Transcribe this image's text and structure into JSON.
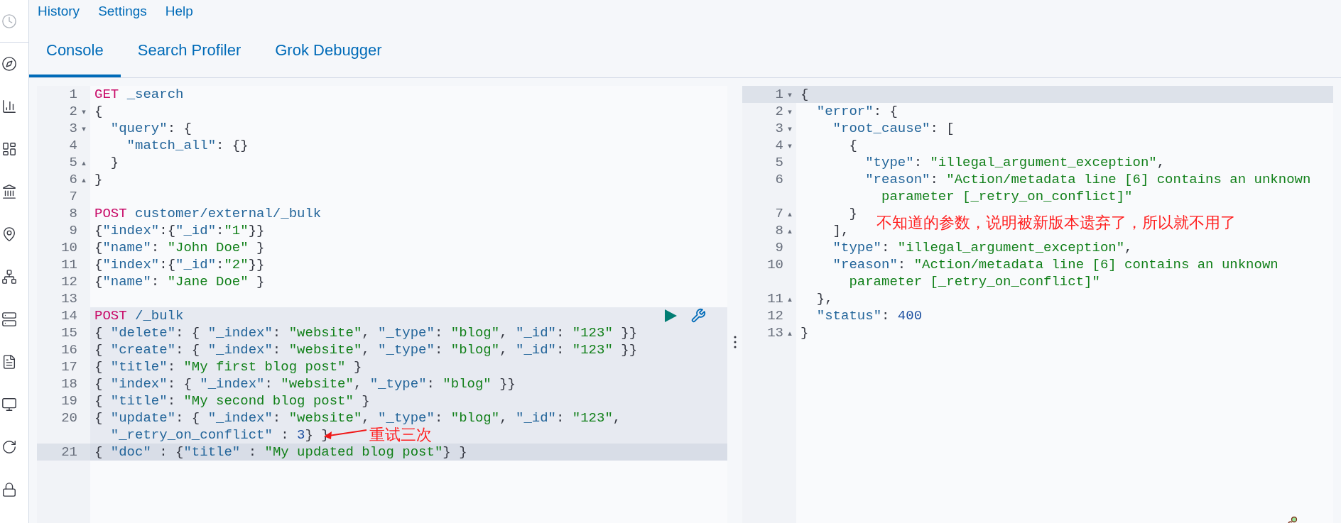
{
  "menu": [
    "History",
    "Settings",
    "Help"
  ],
  "tabs": [
    {
      "label": "Console",
      "selected": true
    },
    {
      "label": "Search Profiler",
      "selected": false
    },
    {
      "label": "Grok Debugger",
      "selected": false
    }
  ],
  "request_editor": {
    "note": "重试三次",
    "lines": [
      {
        "number": "1",
        "method": "GET",
        "path": "_search",
        "in_request": false,
        "active": false
      },
      {
        "number": "2",
        "text": "{",
        "fold": "▾",
        "in_request": false,
        "active": false
      },
      {
        "number": "3",
        "text": "  \"query\": {",
        "fold": "▾",
        "in_request": false,
        "active": false
      },
      {
        "number": "4",
        "text": "    \"match_all\": {}",
        "in_request": false,
        "active": false
      },
      {
        "number": "5",
        "text": "  }",
        "fold": "▴",
        "in_request": false,
        "active": false
      },
      {
        "number": "6",
        "text": "}",
        "fold": "▴",
        "in_request": false,
        "active": false
      },
      {
        "number": "7",
        "in_request": false,
        "active": false
      },
      {
        "number": "8",
        "method": "POST",
        "path": "customer/external/_bulk",
        "in_request": false,
        "active": false
      },
      {
        "number": "9",
        "text": "{\"index\":{\"_id\":\"1\"}}",
        "in_request": false,
        "active": false
      },
      {
        "number": "10",
        "text": "{\"name\": \"John Doe\" }",
        "in_request": false,
        "active": false
      },
      {
        "number": "11",
        "text": "{\"index\":{\"_id\":\"2\"}}",
        "in_request": false,
        "active": false
      },
      {
        "number": "12",
        "text": "{\"name\": \"Jane Doe\" }",
        "in_request": false,
        "active": false
      },
      {
        "number": "13",
        "in_request": false,
        "active": false
      },
      {
        "number": "14",
        "method": "POST",
        "path": "/_bulk",
        "in_request": true,
        "active": false
      },
      {
        "number": "15",
        "text": "{ \"delete\": { \"_index\": \"website\", \"_type\": \"blog\", \"_id\": \"123\" }}",
        "in_request": true,
        "active": false
      },
      {
        "number": "16",
        "text": "{ \"create\": { \"_index\": \"website\", \"_type\": \"blog\", \"_id\": \"123\" }}",
        "in_request": true,
        "active": false
      },
      {
        "number": "17",
        "text": "{ \"title\": \"My first blog post\" }",
        "in_request": true,
        "active": false
      },
      {
        "number": "18",
        "text": "{ \"index\": { \"_index\": \"website\", \"_type\": \"blog\" }}",
        "in_request": true,
        "active": false
      },
      {
        "number": "19",
        "text": "{ \"title\": \"My second blog post\" }",
        "in_request": true,
        "active": false
      },
      {
        "number": "20",
        "text": "{ \"update\": { \"_index\": \"website\", \"_type\": \"blog\", \"_id\": \"123\",",
        "wrap": "  \"_retry_on_conflict\" : 3} }",
        "in_request": true,
        "active": false
      },
      {
        "number": "21",
        "text": "{ \"doc\" : {\"title\" : \"My updated blog post\"} }",
        "in_request": true,
        "active": true
      }
    ]
  },
  "response_viewer": {
    "note": "不知道的参数，说明被新版本遗弃了，所以就不用了",
    "lines": [
      {
        "number": "1",
        "text": "{",
        "fold": "▾",
        "active": true
      },
      {
        "number": "2",
        "text": "  \"error\": {",
        "fold": "▾",
        "active": false
      },
      {
        "number": "3",
        "text": "    \"root_cause\": [",
        "fold": "▾",
        "active": false
      },
      {
        "number": "4",
        "text": "      {",
        "fold": "▾",
        "active": false
      },
      {
        "number": "5",
        "text": "        \"type\": \"illegal_argument_exception\",",
        "active": false
      },
      {
        "number": "6",
        "text": "        \"reason\": \"Action/metadata line [6] contains an unknown",
        "wrap": "          parameter [_retry_on_conflict]\"",
        "active": false
      },
      {
        "number": "7",
        "text": "      }",
        "fold": "▴",
        "active": false
      },
      {
        "number": "8",
        "text": "    ],",
        "fold": "▴",
        "active": false
      },
      {
        "number": "9",
        "text": "    \"type\": \"illegal_argument_exception\",",
        "active": false
      },
      {
        "number": "10",
        "text": "    \"reason\": \"Action/metadata line [6] contains an unknown",
        "wrap": "      parameter [_retry_on_conflict]\"",
        "active": false
      },
      {
        "number": "11",
        "text": "  },",
        "fold": "▴",
        "active": false
      },
      {
        "number": "12",
        "text": "  \"status\": 400",
        "active": false
      },
      {
        "number": "13",
        "text": "}",
        "fold": "▴",
        "active": false
      }
    ]
  }
}
